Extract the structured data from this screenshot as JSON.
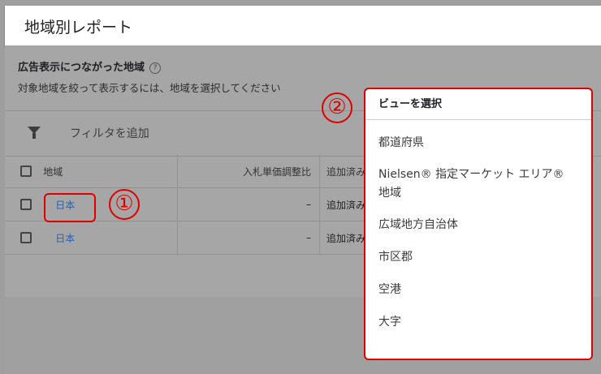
{
  "header": {
    "title": "地域別レポート"
  },
  "section": {
    "title": "広告表示につながった地域",
    "help_icon": "?",
    "subtitle": "対象地域を絞って表示するには、地域を選択してください"
  },
  "filter": {
    "label": "フィルタを追加"
  },
  "table": {
    "columns": [
      "地域",
      "入札単価調整比",
      "追加済み"
    ],
    "rows": [
      {
        "region": "日本",
        "bid": "–",
        "status": "追加済み"
      },
      {
        "region": "日本",
        "bid": "–",
        "status": "追加済み"
      }
    ]
  },
  "annotations": {
    "one": "①",
    "two": "②"
  },
  "view_menu": {
    "title": "ビューを選択",
    "items": [
      "都道府県",
      "Nielsen® 指定マーケット エリア® 地域",
      "広域地方自治体",
      "市区郡",
      "空港",
      "大字"
    ]
  },
  "colors": {
    "annotation": "#e00000",
    "link": "#2a5fb0"
  }
}
